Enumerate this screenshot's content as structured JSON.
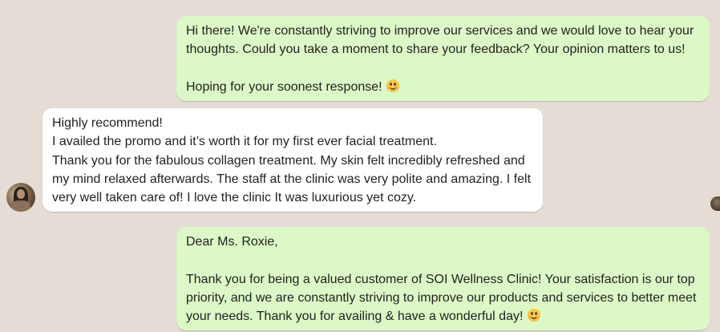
{
  "colors": {
    "background": "#e5ddd5",
    "outgoing_bubble": "#dcf8c6",
    "incoming_bubble": "#ffffff"
  },
  "messages": [
    {
      "direction": "outgoing",
      "lines": [
        "Hi there! We're constantly striving to improve our services and we would love to hear your",
        "thoughts. Could you take a moment to share your feedback? Your opinion matters to us!",
        "",
        "Hoping for your soonest response!"
      ],
      "emoji": "smiling-face-emoji"
    },
    {
      "direction": "incoming",
      "sender_avatar": "customer-avatar",
      "lines": [
        "Highly recommend!",
        "I availed the promo and it’s worth it for my first ever facial treatment.",
        "Thank you for the fabulous collagen treatment. My skin felt incredibly refreshed and",
        "my mind relaxed afterwards. The staff at the clinic was very polite and amazing. I felt",
        "very well taken care of! I love the clinic It was luxurious yet cozy."
      ]
    },
    {
      "direction": "outgoing",
      "lines": [
        "Dear Ms. Roxie,",
        "",
        "Thank you for being a valued customer of SOI Wellness Clinic! Your satisfaction is our top",
        "priority, and we are constantly striving to improve our products and services to better meet",
        "your needs. Thank you for availing & have a wonderful day!"
      ],
      "emoji": "smiling-face-emoji"
    }
  ]
}
